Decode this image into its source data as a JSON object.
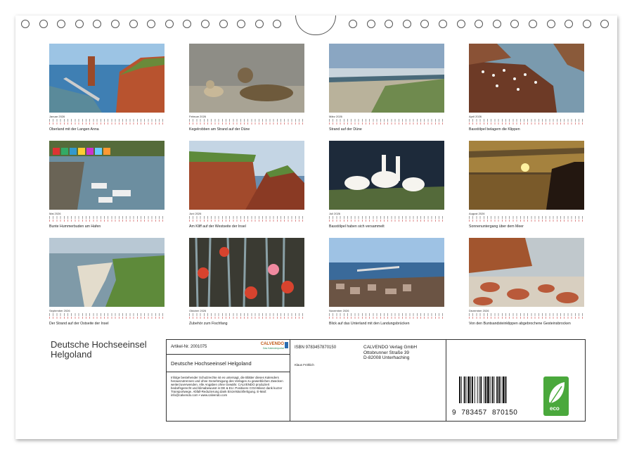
{
  "calendar": {
    "title": "Deutsche Hochseeinsel Helgoland",
    "months": [
      {
        "month": "Januar 2026",
        "caption": "Oberland mit der Langen Anna",
        "scene": "cliff-sea"
      },
      {
        "month": "Februar 2026",
        "caption": "Kegelrobben am Strand auf der Düne",
        "scene": "seals"
      },
      {
        "month": "März 2026",
        "caption": "Strand auf der Düne",
        "scene": "dune-beach"
      },
      {
        "month": "April 2026",
        "caption": "Basstölpel belagern die Klippen",
        "scene": "birds-rock"
      },
      {
        "month": "Mai 2026",
        "caption": "Bunte Hummerbuden am Hafen",
        "scene": "harbour"
      },
      {
        "month": "Juni 2026",
        "caption": "Am Kliff auf der Westseite der Insel",
        "scene": "red-cliff"
      },
      {
        "month": "Juli 2026",
        "caption": "Basstölpel haben sich versammelt",
        "scene": "gannets"
      },
      {
        "month": "August 2026",
        "caption": "Sonnenuntergang über dem Meer",
        "scene": "sunset"
      },
      {
        "month": "September 2026",
        "caption": "Der Strand auf der Ostseite der Insel",
        "scene": "east-beach"
      },
      {
        "month": "Oktober 2026",
        "caption": "Zubehör zum Fischfang",
        "scene": "nets"
      },
      {
        "month": "November 2026",
        "caption": "Blick auf das Unterland mit den Landungsbrücken",
        "scene": "town"
      },
      {
        "month": "Dezember 2026",
        "caption": "Von den Buntsandsteinklippen abgebrochene Gesteinsbrocken",
        "scene": "rocks"
      }
    ]
  },
  "info": {
    "article": "Artikel-Nr. 2001075",
    "brand": "CALVENDO",
    "brand_sub": "Das Kalenderportal",
    "product_title": "Deutsche Hochseeinsel Helgoland",
    "legal": "Infolge bestehender Schutzrechte ist es untersagt, die Blätter dieses Kalenders herauszutrennen und ohne Genehmigung des Verlages zu gewerblichen Zwecken weiterzuverwenden. Alle Angaben ohne Gewähr. CALVENDO produziert bedarfsgerecht und klimabewusst in DE & EU. Positivere CO2-Bilanz dank kurzer Transportwege. Abfall-Reduzierung dank Einzelstückfertigung. E-Mail: info@calvendo.com • www.calvendo.com",
    "isbn": "ISBN 9783457870150",
    "publisher_name": "CALVENDO Verlag GmbH",
    "publisher_street": "Ottobrunner Straße 39",
    "publisher_city": "D-82008 Unterhaching",
    "author": "Klaus Fröhlich",
    "barcode_first": "9",
    "barcode_mid": "783457",
    "barcode_end": "870150",
    "eco_label": "eco"
  }
}
